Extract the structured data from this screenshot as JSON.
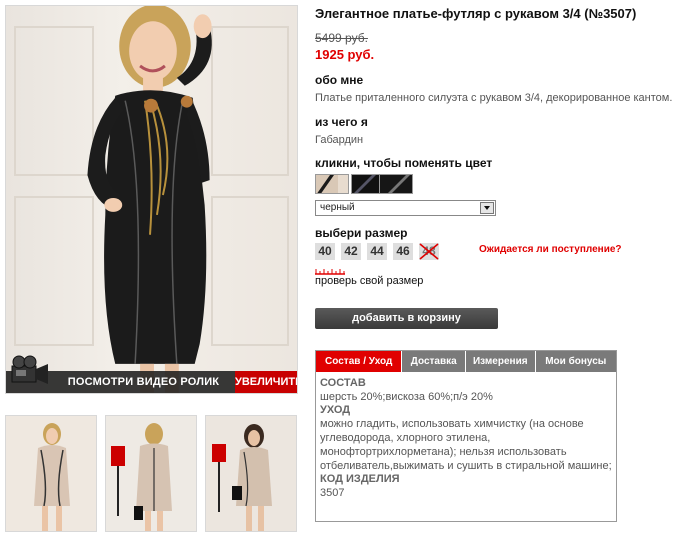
{
  "photo": {
    "video_label": "посмотри видео ролик",
    "zoom_label": "увеличить"
  },
  "product": {
    "title": "Элегантное платье-футляр с рукавом 3/4 (№3507)",
    "old_price": "5499 руб.",
    "new_price": "1925 руб."
  },
  "about": {
    "heading": "обо мне",
    "text": "Платье приталенного силуэта с рукавом 3/4, декорированное кантом."
  },
  "material": {
    "heading": "из чего я",
    "text": "Габардин"
  },
  "color": {
    "heading": "кликни, чтобы поменять цвет",
    "selected": "черный"
  },
  "size": {
    "heading": "выбери размер",
    "options": [
      "40",
      "42",
      "44",
      "46",
      "48"
    ],
    "notify": "Ожидается ли поступление?",
    "check": "проверь свой размер"
  },
  "cart": {
    "label": "добавить в корзину"
  },
  "tabs": {
    "items": [
      "Состав / Уход",
      "Доставка",
      "Измерения",
      "Мои бонусы"
    ],
    "composition_head": "СОСТАВ",
    "composition_text": "шерсть 20%;вискоза 60%;п/э 20%",
    "care_head": "УХОД",
    "care_text": "можно гладить, использовать химчистку (на основе углеводорода, хлорного этилена, монофтортрихлорметана); нельзя использовать отбеливатель,выжимать и сушить в стиральной машине;",
    "code_head": "КОД ИЗДЕЛИЯ",
    "code_text": "3507"
  },
  "colors": {
    "accent": "#e00000",
    "tab_inactive": "#7a7a7a",
    "button": "#4a4a4a"
  }
}
